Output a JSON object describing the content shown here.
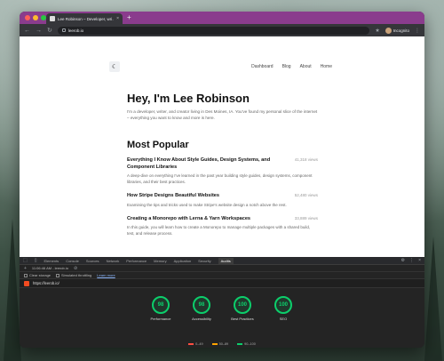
{
  "browser": {
    "tab_title": "Lee Robinson – Developer, wri…",
    "url": "leerob.io",
    "profile_name": "Incognito"
  },
  "site": {
    "logo_glyph": "☾",
    "nav": [
      "Dashboard",
      "Blog",
      "About",
      "Home"
    ],
    "hero_title": "Hey, I'm Lee Robinson",
    "hero_text": "I'm a developer, writer, and creator living in Des Moines, IA. You've found my personal slice of the internet – everything you want to know and more is here.",
    "section_title": "Most Popular",
    "posts": [
      {
        "title": "Everything I Know About Style Guides, Design Systems, and Component Libraries",
        "views": "41,318 views",
        "description": "A deep-dive on everything I've learned in the past year building style guides, design systems, component libraries, and their best practices."
      },
      {
        "title": "How Stripe Designs Beautiful Websites",
        "views": "52,480 views",
        "description": "Examining the tips and tricks used to make Stripe's website design a notch above the rest."
      },
      {
        "title": "Creating a Monorepo with Lerna & Yarn Workspaces",
        "views": "33,889 views",
        "description": "In this guide, you will learn how to create a Monorepo to manage multiple packages with a shared build, test, and release process."
      }
    ]
  },
  "devtools": {
    "tabs": [
      "Elements",
      "Console",
      "Sources",
      "Network",
      "Performance",
      "Memory",
      "Application",
      "Security",
      "Audits"
    ],
    "active_tab": "Audits",
    "report_time": "11:06:46 AM - leerob.io",
    "clear_storage": "Clear storage",
    "throttling": "Simulated throttling",
    "learn_more": "Learn more",
    "report_url": "https://leerob.io/",
    "scores": [
      {
        "value": "98",
        "label": "Performance"
      },
      {
        "value": "98",
        "label": "Accessibility"
      },
      {
        "value": "100",
        "label": "Best Practices"
      },
      {
        "value": "100",
        "label": "SEO"
      }
    ],
    "legend": [
      {
        "range": "0–49",
        "color": "#ff4e42"
      },
      {
        "range": "50–89",
        "color": "#ffa400"
      },
      {
        "range": "90–100",
        "color": "#0cce6b"
      }
    ]
  }
}
